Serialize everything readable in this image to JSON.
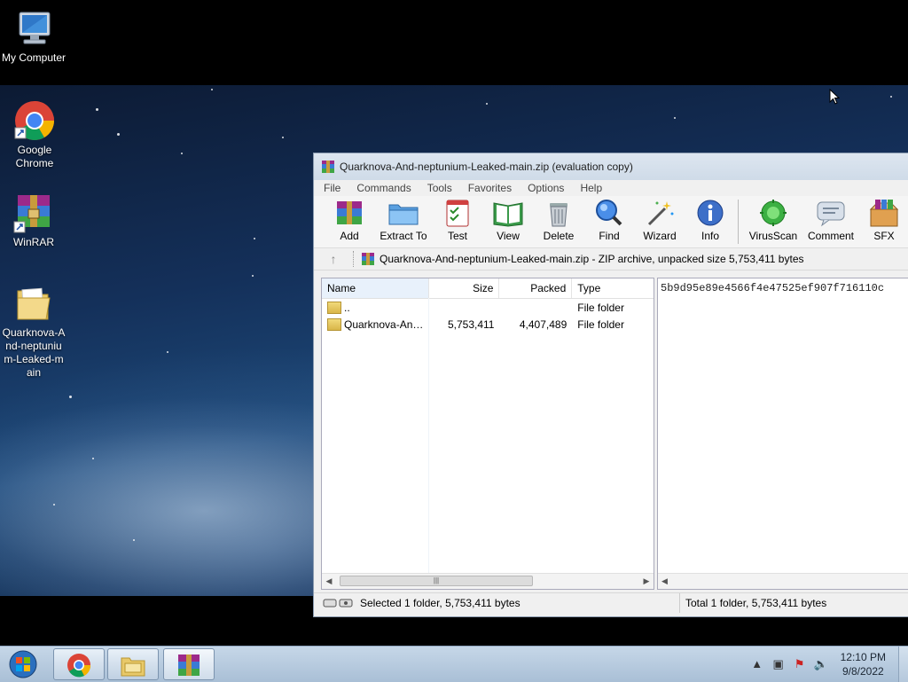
{
  "desktop": {
    "icons": [
      {
        "label": "My Computer"
      },
      {
        "label": "Google Chrome"
      },
      {
        "label": "WinRAR"
      },
      {
        "label": "Quarknova-And-neptunium-Leaked-main"
      }
    ]
  },
  "window": {
    "title": "Quarknova-And-neptunium-Leaked-main.zip (evaluation copy)",
    "menu": [
      "File",
      "Commands",
      "Tools",
      "Favorites",
      "Options",
      "Help"
    ],
    "toolbar": [
      "Add",
      "Extract To",
      "Test",
      "View",
      "Delete",
      "Find",
      "Wizard",
      "Info",
      "VirusScan",
      "Comment",
      "SFX"
    ],
    "address": "Quarknova-And-neptunium-Leaked-main.zip - ZIP archive, unpacked size 5,753,411 bytes",
    "columns": {
      "name": "Name",
      "size": "Size",
      "packed": "Packed",
      "type": "Type"
    },
    "rows": [
      {
        "name": "..",
        "size": "",
        "packed": "",
        "type": "File folder"
      },
      {
        "name": "Quarknova-And...",
        "size": "5,753,411",
        "packed": "4,407,489",
        "type": "File folder"
      }
    ],
    "comment": "5b9d95e89e4566f4e47525ef907f716110c",
    "status_left": "Selected 1 folder, 5,753,411 bytes",
    "status_right": "Total 1 folder, 5,753,411 bytes"
  },
  "taskbar": {
    "time": "12:10 PM",
    "date": "9/8/2022"
  }
}
